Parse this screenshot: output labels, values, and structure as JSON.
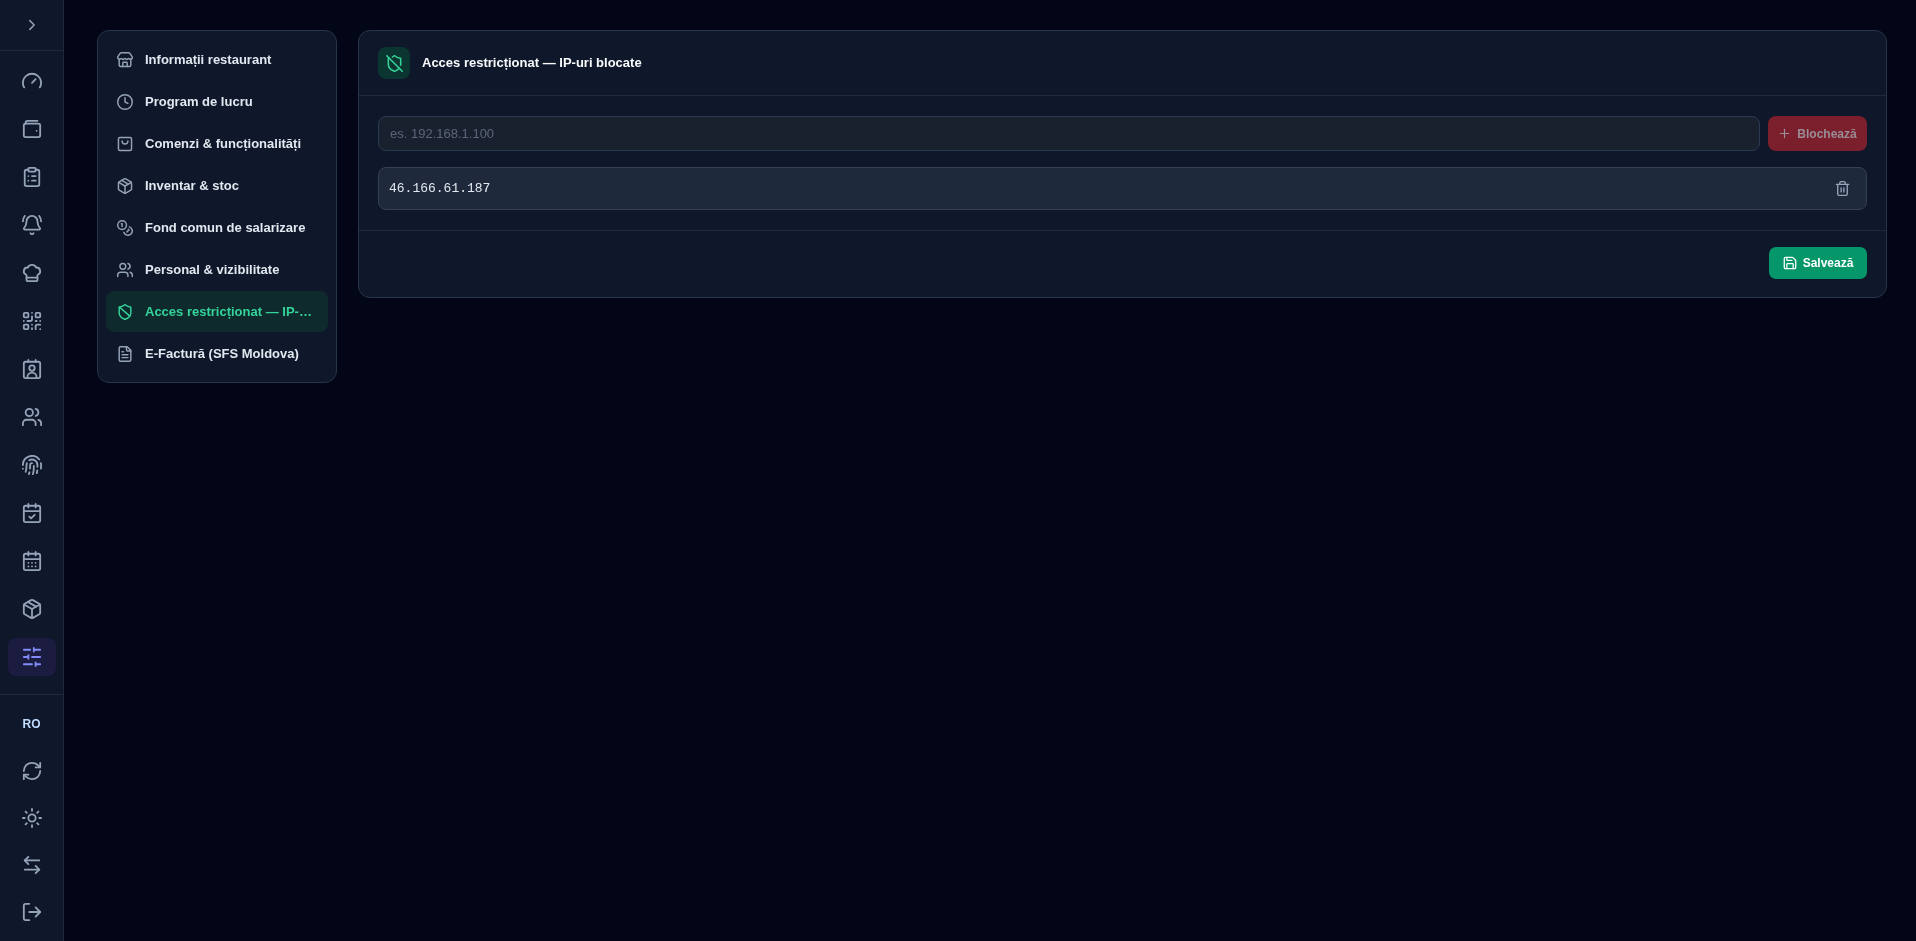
{
  "rail": {
    "items": [
      {
        "selected": false
      },
      {
        "selected": false
      },
      {
        "selected": false
      },
      {
        "selected": false
      },
      {
        "selected": false
      },
      {
        "selected": false
      },
      {
        "selected": false
      },
      {
        "selected": false
      },
      {
        "selected": false
      },
      {
        "selected": false
      },
      {
        "selected": false
      },
      {
        "selected": false
      },
      {
        "selected": true
      }
    ],
    "language": "RO"
  },
  "settings_nav": [
    {
      "label": "Informații restaurant",
      "selected": false
    },
    {
      "label": "Program de lucru",
      "selected": false
    },
    {
      "label": "Comenzi & funcționalități",
      "selected": false
    },
    {
      "label": "Inventar & stoc",
      "selected": false
    },
    {
      "label": "Fond comun de salarizare",
      "selected": false
    },
    {
      "label": "Personal & vizibilitate",
      "selected": false
    },
    {
      "label": "Acces restricționat — IP-…",
      "selected": true
    },
    {
      "label": "E-Factură (SFS Moldova)",
      "selected": false
    }
  ],
  "panel": {
    "title": "Acces restricționat — IP-uri blocate",
    "ip_input": {
      "placeholder": "es. 192.168.1.100"
    },
    "block_button": {
      "label": "Blochează",
      "disabled": true
    },
    "blocked_ips": [
      {
        "address": "46.166.61.187"
      }
    ],
    "save_button": {
      "label": "Salvează"
    }
  }
}
